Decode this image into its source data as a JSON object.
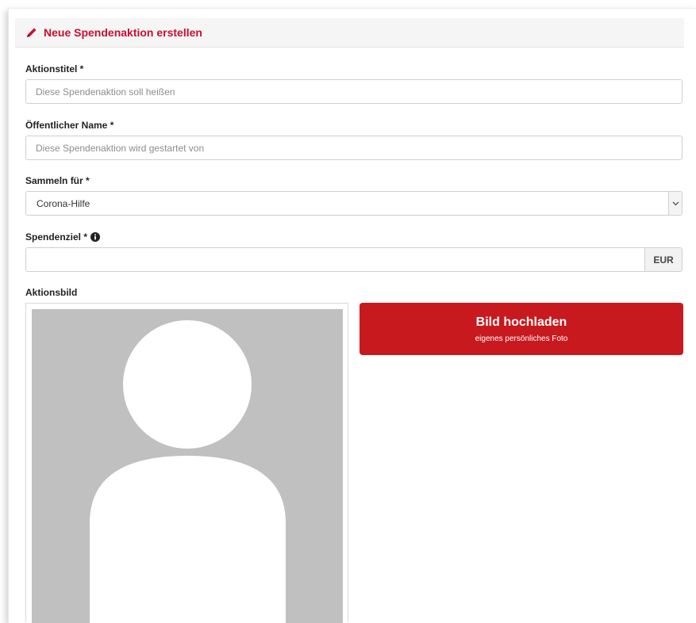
{
  "header": {
    "title": "Neue Spendenaktion erstellen",
    "icon": "pencil-icon",
    "accent": "#c8102e"
  },
  "fields": {
    "title": {
      "label": "Aktionstitel *",
      "placeholder": "Diese Spendenaktion soll heißen",
      "value": ""
    },
    "public_name": {
      "label": "Öffentlicher Name *",
      "placeholder": "Diese Spendenaktion wird gestartet von",
      "value": ""
    },
    "collect_for": {
      "label": "Sammeln für  *",
      "selected": "Corona-Hilfe"
    },
    "goal": {
      "label": "Spendenziel *",
      "value": "",
      "currency": "EUR"
    }
  },
  "image": {
    "label": "Aktionsbild",
    "upload_button": {
      "title": "Bild hochladen",
      "subtitle": "eigenes persönliches Foto",
      "color": "#c8191f"
    }
  }
}
